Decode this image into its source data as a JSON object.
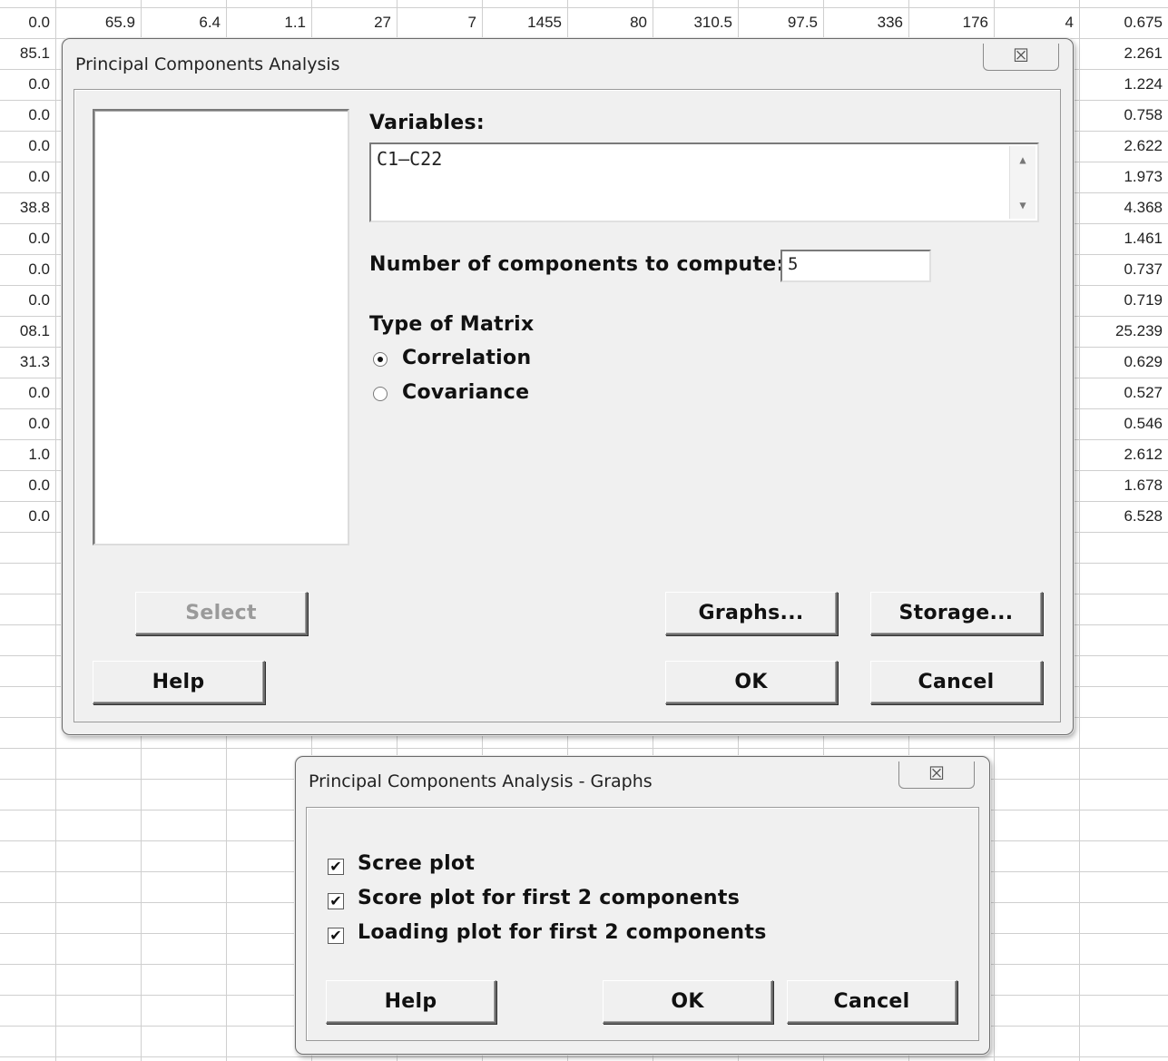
{
  "spreadsheet": {
    "row1": [
      "0.0",
      "65.9",
      "6.4",
      "1.1",
      "27",
      "7",
      "1455",
      "80",
      "310.5",
      "97.5",
      "336",
      "176",
      "4",
      "0.675"
    ],
    "left_col": [
      "85.1",
      "0.0",
      "0.0",
      "0.0",
      "0.0",
      "38.8",
      "0.0",
      "0.0",
      "0.0",
      "08.1",
      "31.3",
      "0.0",
      "0.0",
      "1.0",
      "0.0",
      "0.0"
    ],
    "right_col": [
      "2.261",
      "1.224",
      "0.758",
      "2.622",
      "1.973",
      "4.368",
      "1.461",
      "0.737",
      "0.719",
      "25.239",
      "0.629",
      "0.527",
      "0.546",
      "2.612",
      "1.678",
      "6.528"
    ]
  },
  "pca_dialog": {
    "title": "Principal Components Analysis",
    "close_icon": "close-x-icon",
    "close_glyph": "☒",
    "variables_label": "Variables:",
    "variables_value": "C1–C22",
    "num_components_label": "Number of components to compute:",
    "num_components_value": "5",
    "matrix_type_label": "Type of Matrix",
    "matrix_options": [
      "Correlation",
      "Covariance"
    ],
    "selected_matrix": "Correlation",
    "select_button": "Select",
    "graphs_button": "Graphs...",
    "storage_button": "Storage...",
    "help_button": "Help",
    "ok_button": "OK",
    "cancel_button": "Cancel",
    "scroll_up_glyph": "▲",
    "scroll_down_glyph": "▼"
  },
  "graphs_dialog": {
    "title": "Principal Components Analysis - Graphs",
    "close_glyph": "☒",
    "options": [
      {
        "label": "Scree plot",
        "checked": true
      },
      {
        "label": "Score plot for first 2 components",
        "checked": true
      },
      {
        "label": "Loading plot for first 2 components",
        "checked": true
      }
    ],
    "check_glyph": "✔",
    "help_button": "Help",
    "ok_button": "OK",
    "cancel_button": "Cancel"
  }
}
